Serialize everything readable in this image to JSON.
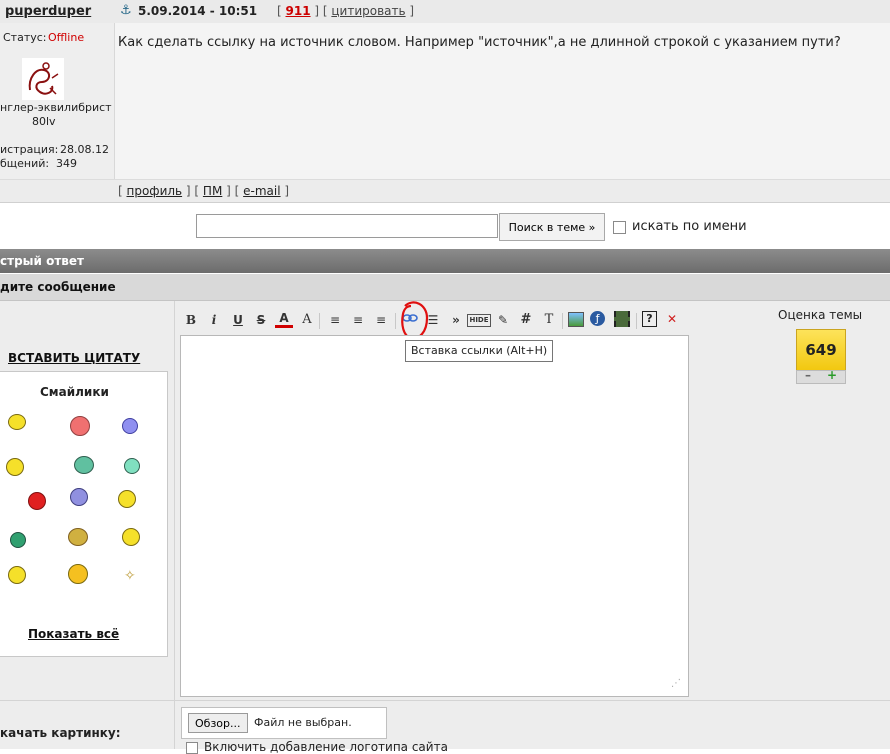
{
  "post": {
    "author": "puperduper",
    "date": "5.09.2014 - 10:51",
    "post_number": "911",
    "quote_link": "цитировать",
    "status_label": "Статус:",
    "status_value": "Offline",
    "user_rank": "нглер-эквилибрист",
    "user_level": "80lv",
    "reg_label": "истрация:",
    "reg_date": "28.08.12",
    "posts_label": "бщений:",
    "posts_count": "349",
    "message": "Как сделать ссылку на источник словом. Например \"источник\",а не длинной строкой с указанием пути?",
    "footer_links": [
      "профиль",
      "ПМ",
      "e-mail"
    ]
  },
  "search": {
    "value": "",
    "button_label": "Поиск в теме »",
    "by_name_label": "искать по имени"
  },
  "quick_reply": {
    "title": "стрый ответ",
    "subtitle": "дите сообщение"
  },
  "sidebar": {
    "insert_quote": "ВСТАВИТЬ ЦИТАТУ",
    "smilies_title": "Смайлики",
    "show_all": "Показать всё"
  },
  "toolbar": {
    "buttons": [
      "B",
      "i",
      "U",
      "S",
      "A",
      "A",
      "≡",
      "≡",
      "≡",
      "link",
      "list",
      "»",
      "HIDE",
      "edit",
      "#",
      "T",
      "image",
      "flash",
      "video",
      "help",
      "close"
    ],
    "tooltip": "Вставка ссылки (Alt+H)"
  },
  "rating": {
    "label": "Оценка темы",
    "value": "649",
    "minus": "–",
    "plus": "+"
  },
  "upload": {
    "label": "качать картинку:",
    "browse_button": "Обзор...",
    "no_file": "Файл не выбран.",
    "logo_checkbox": "Включить добавление логотипа сайта"
  },
  "colors": {
    "offline": "#d00000",
    "post_number": "#cc0000",
    "rating_bg": "#f7d21c",
    "annotation": "#e01010"
  }
}
